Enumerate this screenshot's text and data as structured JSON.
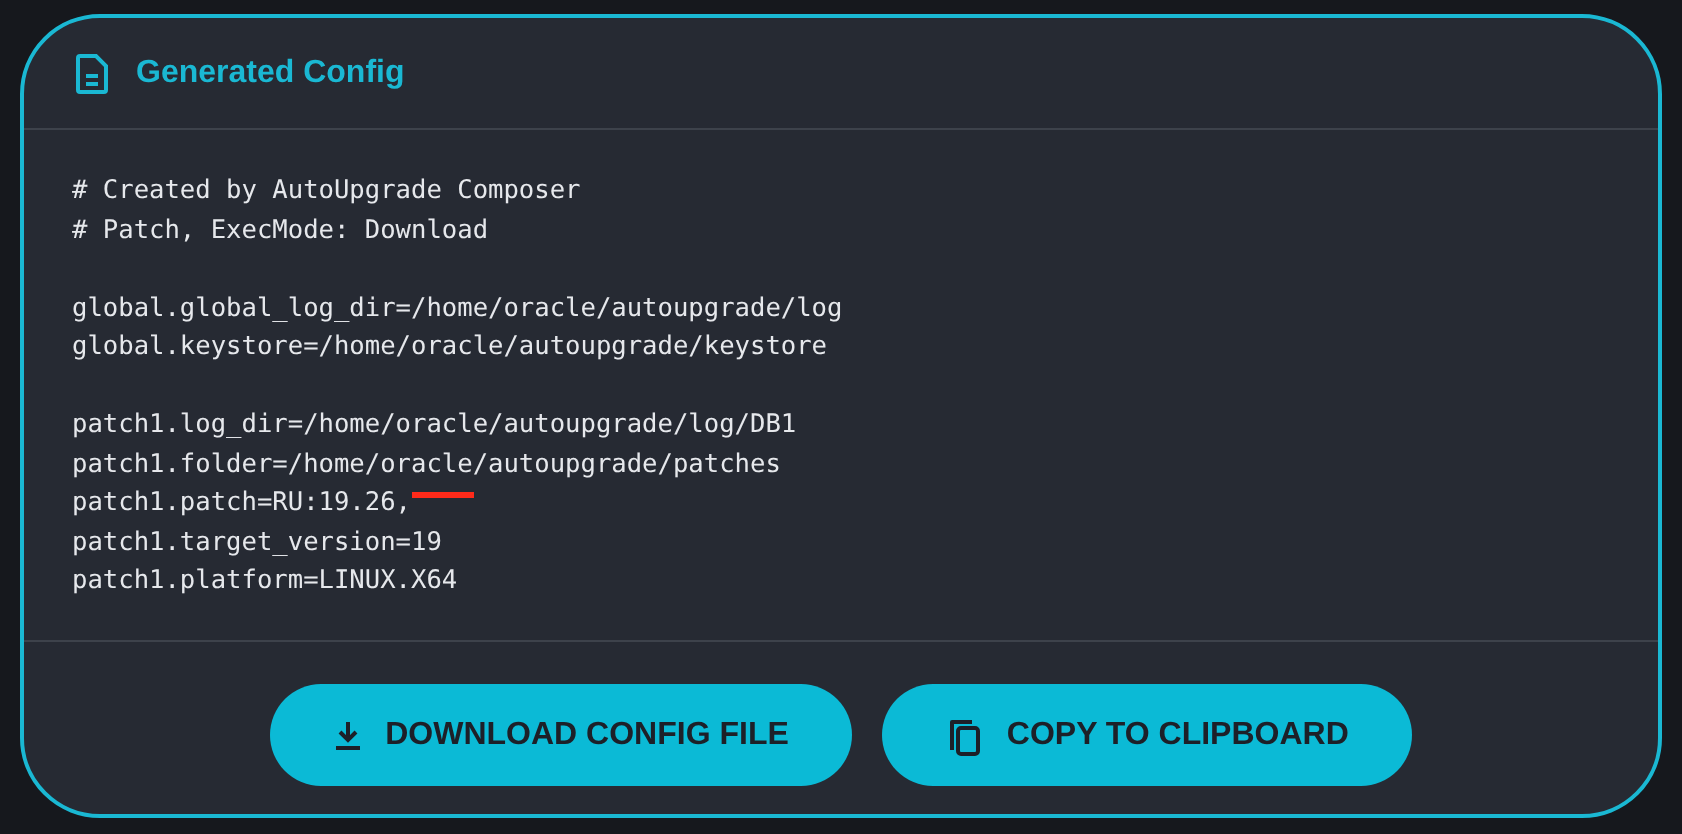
{
  "card": {
    "title": "Generated Config"
  },
  "config_blocks": [
    [
      {
        "text": "# Created by AutoUpgrade Composer"
      },
      {
        "text": "# Patch, ExecMode: Download"
      }
    ],
    [
      {
        "text": "global.global_log_dir=/home/oracle/autoupgrade/log"
      },
      {
        "text": "global.keystore=/home/oracle/autoupgrade/keystore"
      }
    ],
    [
      {
        "text": "patch1.log_dir=/home/oracle/autoupgrade/log/DB1"
      },
      {
        "text": "patch1.folder=/home/oracle/autoupgrade/patches"
      },
      {
        "text": "patch1.patch=RU:19.26,",
        "scribbled": true
      },
      {
        "text": "patch1.target_version=19"
      },
      {
        "text": "patch1.platform=LINUX.X64"
      }
    ]
  ],
  "buttons": [
    {
      "label": "DOWNLOAD CONFIG FILE",
      "kind": "download"
    },
    {
      "label": "COPY TO CLIPBOARD",
      "kind": "copy"
    }
  ]
}
